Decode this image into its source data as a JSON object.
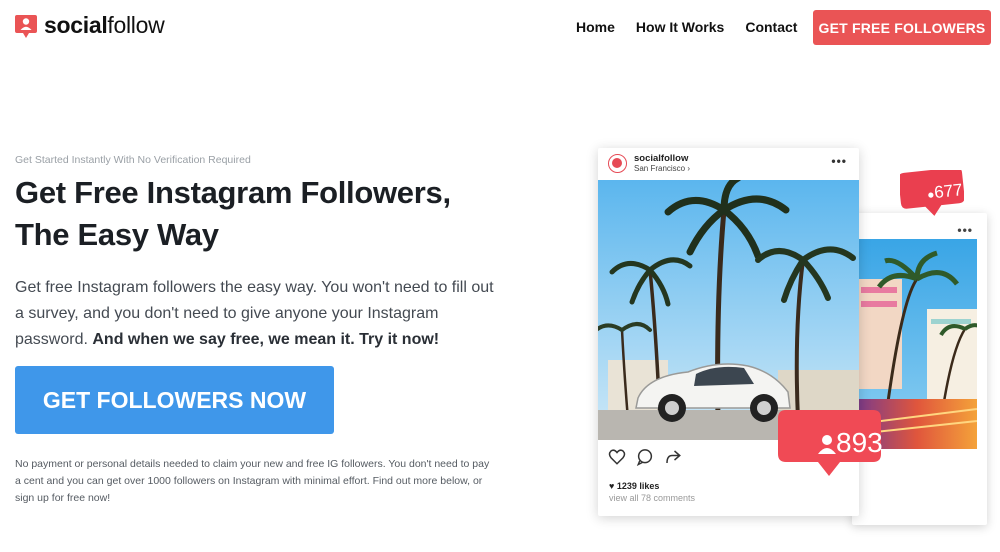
{
  "header": {
    "logo_bold": "social",
    "logo_light": "follow",
    "nav": [
      {
        "label": "Home"
      },
      {
        "label": "How It Works"
      },
      {
        "label": "Contact"
      }
    ],
    "cta_label": "GET FREE FOLLOWERS"
  },
  "hero": {
    "kicker": "Get Started Instantly With No Verification Required",
    "headline_line1": "Get Free Instagram Followers,",
    "headline_line2": "The Easy Way",
    "body": "Get free Instagram followers the easy way. You won't need to fill out a survey, and you don't need to give anyone your Instagram password.",
    "body_bold": "And when we say free, we mean it. Try it now!",
    "cta_label": "GET FOLLOWERS NOW",
    "fine_print": "No payment or personal details needed to claim your new and free IG followers. You don't need to pay a cent and you can get over 1000 followers on Instagram with minimal effort. Find out more below, or sign up for free now!"
  },
  "mockup": {
    "post_user": "socialfollow",
    "post_location": "San Francisco",
    "likes": "1239 likes",
    "comments": "view all 78 comments",
    "badge_big": "893",
    "badge_small": "677",
    "menu_dots": "•••"
  },
  "colors": {
    "brand_red": "#ea5455",
    "cta_blue": "#3f97ea"
  },
  "icons": [
    "logo-pin-icon",
    "heart-icon",
    "comment-icon",
    "share-icon",
    "user-icon",
    "more-dots-icon",
    "chevron-right-icon"
  ]
}
